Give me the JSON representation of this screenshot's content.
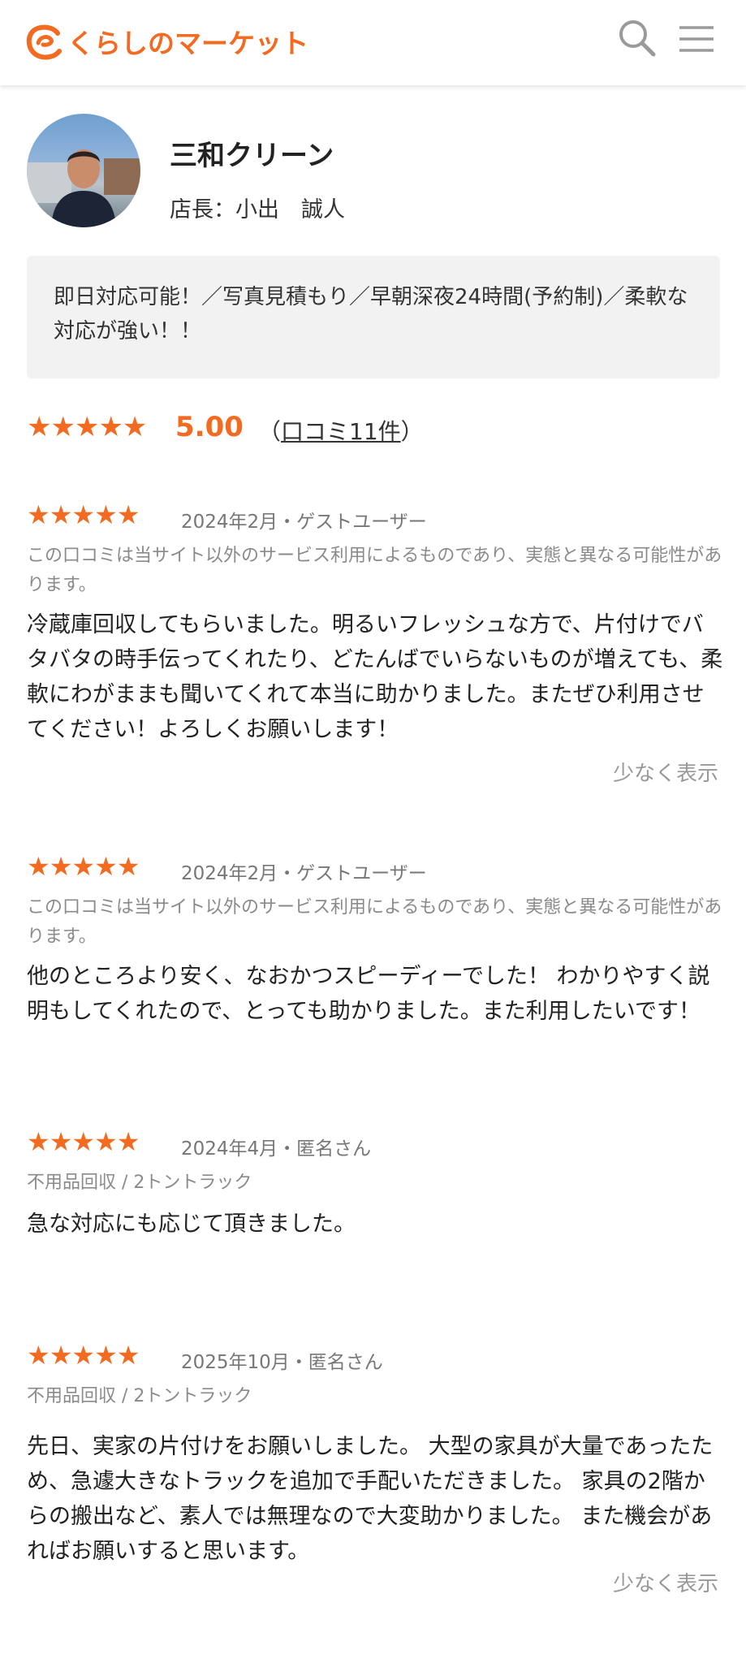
{
  "header": {
    "logo_text": "くらしのマーケット",
    "brand_color": "#f26b21",
    "search_icon": "search-icon",
    "menu_icon": "hamburger-menu-icon"
  },
  "profile": {
    "shop_name": "三和クリーン",
    "manager": "店長：小出　誠人"
  },
  "catch_copy": "即日対応可能！／写真見積もり／早朝深夜24時間(予約制)／柔軟な対応が強い！！",
  "rating": {
    "stars": "★★★★★",
    "score": "5.00",
    "count_open": "（",
    "count_link": "口コミ11件",
    "count_close": "）"
  },
  "reviews": [
    {
      "stars": "★★★★★",
      "meta": "2024年2月・ゲストユーザー",
      "note": "この口コミは当サイト以外のサービス利用によるものであり、実態と異なる可能性があります。",
      "body": "冷蔵庫回収してもらいました。明るいフレッシュな方で、片付けでバタバタの時手伝ってくれたり、どたんばでいらないものが増えても、柔軟にわがままも聞いてくれて本当に助かりました。またぜひ利用させてください！よろしくお願いします！",
      "toggle": "少なく表示"
    },
    {
      "stars": "★★★★★",
      "meta": "2024年2月・ゲストユーザー",
      "note": "この口コミは当サイト以外のサービス利用によるものであり、実態と異なる可能性があります。",
      "body": "他のところより安く、なおかつスピーディーでした！ わかりやすく説明もしてくれたので、とっても助かりました。また利用したいです！"
    },
    {
      "stars": "★★★★★",
      "meta": "2024年4月・匿名さん",
      "note": "不用品回収 / 2トントラック",
      "body": "急な対応にも応じて頂きました。"
    },
    {
      "stars": "★★★★★",
      "meta": "2025年10月・匿名さん",
      "note": "不用品回収 / 2トントラック",
      "body": "先日、実家の片付けをお願いしました。 大型の家具が大量であったため、急遽大きなトラックを追加で手配いただきました。 家具の2階からの搬出など、素人では無理なので大変助かりました。 また機会があればお願いすると思います。",
      "toggle": "少なく表示"
    }
  ]
}
